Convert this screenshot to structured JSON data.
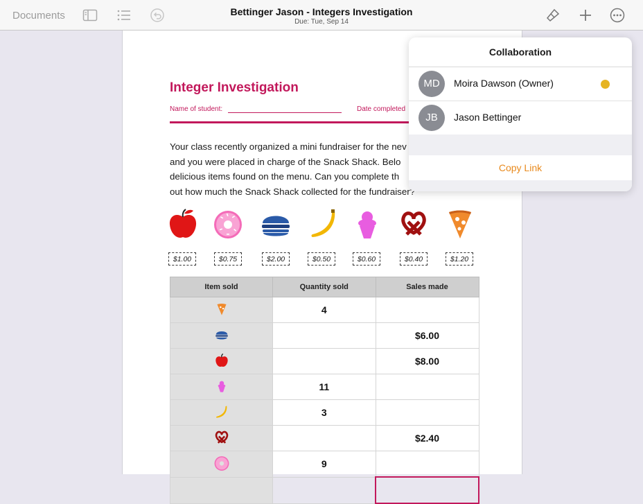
{
  "toolbar": {
    "documents_label": "Documents",
    "title": "Bettinger Jason - Integers Investigation",
    "due": "Due: Tue, Sep 14",
    "icons": [
      "sidebar-icon",
      "list-icon",
      "undo-icon",
      "format-brush-icon",
      "add-icon",
      "more-icon"
    ]
  },
  "document": {
    "title": "Integer Investigation",
    "name_label": "Name of student:",
    "date_label": "Date completed",
    "paragraph_lines": [
      "Your class recently organized a mini fundraiser for the nev",
      "and you were placed in charge of the Snack Shack. Belo",
      "delicious items found on the menu. Can you complete th",
      "out how much the Snack Shack collected for the fundraiser?"
    ],
    "menu": [
      {
        "icon": "apple-icon",
        "price": "$1.00"
      },
      {
        "icon": "donut-icon",
        "price": "$0.75"
      },
      {
        "icon": "burger-icon",
        "price": "$2.00"
      },
      {
        "icon": "banana-icon",
        "price": "$0.50"
      },
      {
        "icon": "ice-cream-icon",
        "price": "$0.60"
      },
      {
        "icon": "pretzel-icon",
        "price": "$0.40"
      },
      {
        "icon": "pizza-icon",
        "price": "$1.20"
      }
    ],
    "table": {
      "headers": [
        "Item sold",
        "Quantity sold",
        "Sales made"
      ],
      "rows": [
        {
          "icon": "pizza-icon",
          "quantity": "4",
          "sales": ""
        },
        {
          "icon": "burger-icon",
          "quantity": "",
          "sales": "$6.00"
        },
        {
          "icon": "apple-icon",
          "quantity": "",
          "sales": "$8.00"
        },
        {
          "icon": "ice-cream-icon",
          "quantity": "11",
          "sales": ""
        },
        {
          "icon": "banana-icon",
          "quantity": "3",
          "sales": ""
        },
        {
          "icon": "pretzel-icon",
          "quantity": "",
          "sales": "$2.40"
        },
        {
          "icon": "donut-icon",
          "quantity": "9",
          "sales": ""
        }
      ]
    }
  },
  "collaboration": {
    "title": "Collaboration",
    "people": [
      {
        "initials": "MD",
        "name": "Moira Dawson (Owner)",
        "status_color": "#e6b422"
      },
      {
        "initials": "JB",
        "name": "Jason Bettinger"
      }
    ],
    "copy_link": "Copy Link"
  },
  "colors": {
    "accent": "#c2185b",
    "link": "#e8891c"
  }
}
